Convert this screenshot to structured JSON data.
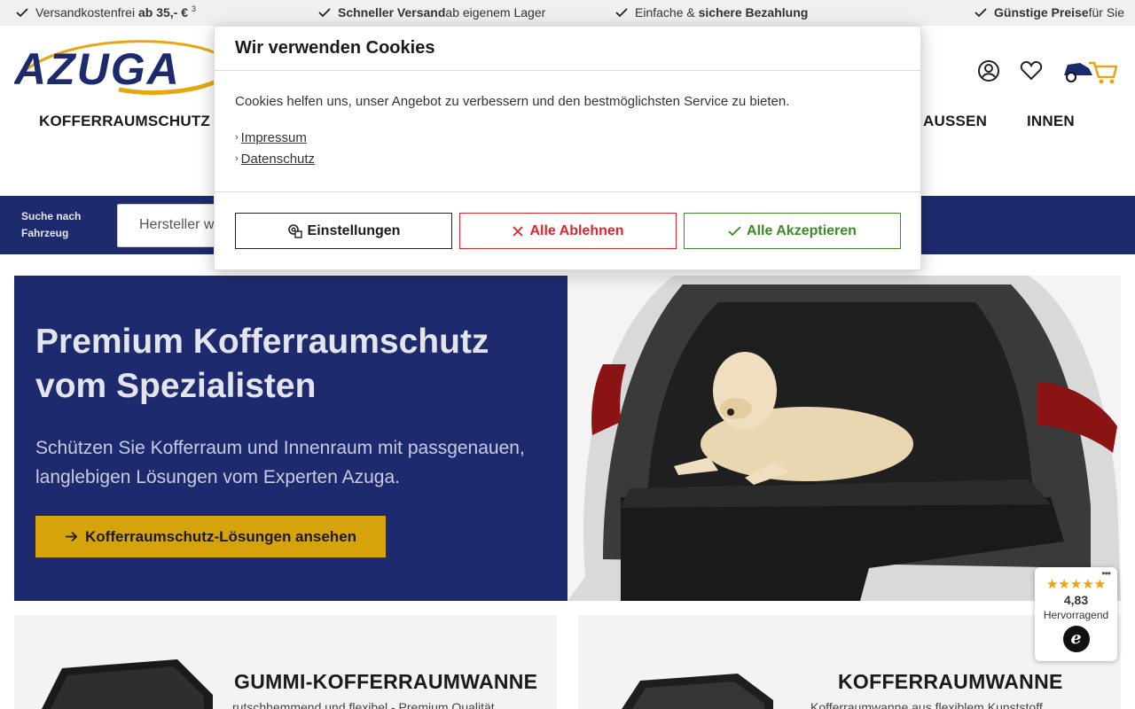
{
  "usp_bar": {
    "item1": {
      "text": "Versandkostenfrei ",
      "bold": "ab 35,- €",
      "sup": "3"
    },
    "item2": {
      "bold": "Schneller Versand",
      "text": " ab eigenem Lager"
    },
    "item3": {
      "text": "Einfache & ",
      "bold": "sichere Bezahlung"
    },
    "item4": {
      "bold": "Günstige Preise",
      "text": " für Sie"
    }
  },
  "header": {
    "logo_text": "AZUGA",
    "nav": [
      "KOFFERRAUMSCHUTZ",
      "AUSSEN",
      "INNEN"
    ]
  },
  "search": {
    "label": "Suche nach Fahrzeug",
    "placeholder": "Hersteller w"
  },
  "hero": {
    "title": "Premium Kofferraumschutz vom Spezialisten",
    "subtitle": "Schützen Sie Kofferraum und Innenraum mit passgenauen, langlebigen Lösungen vom Experten Azuga.",
    "cta": "Kofferraumschutz-Lösungen ansehen"
  },
  "cards": [
    {
      "title": "GUMMI-KOFFERRAUMWANNE",
      "subtitle": "rutschhemmend und flexibel - Premium Qualität"
    },
    {
      "title": "KOFFERRAUMWANNE",
      "subtitle": "Kofferraumwanne aus flexiblem Kunststoff"
    }
  ],
  "cookie": {
    "title": "Wir verwenden Cookies",
    "text": "Cookies helfen uns, unser Angebot zu verbessern und den bestmöglichsten Service zu bieten.",
    "links": [
      "Impressum",
      "Datenschutz"
    ],
    "btn_settings": "Einstellungen",
    "btn_reject": "Alle Ablehnen",
    "btn_accept": "Alle Akzeptieren"
  },
  "badge": {
    "stars": "★★★★★",
    "score": "4,83",
    "label": "Hervorragend",
    "logo": "e"
  },
  "colors": {
    "navy": "#1e2a6e",
    "gold": "#d6a40a",
    "reject": "#d9272e",
    "accept": "#3b8c25"
  }
}
